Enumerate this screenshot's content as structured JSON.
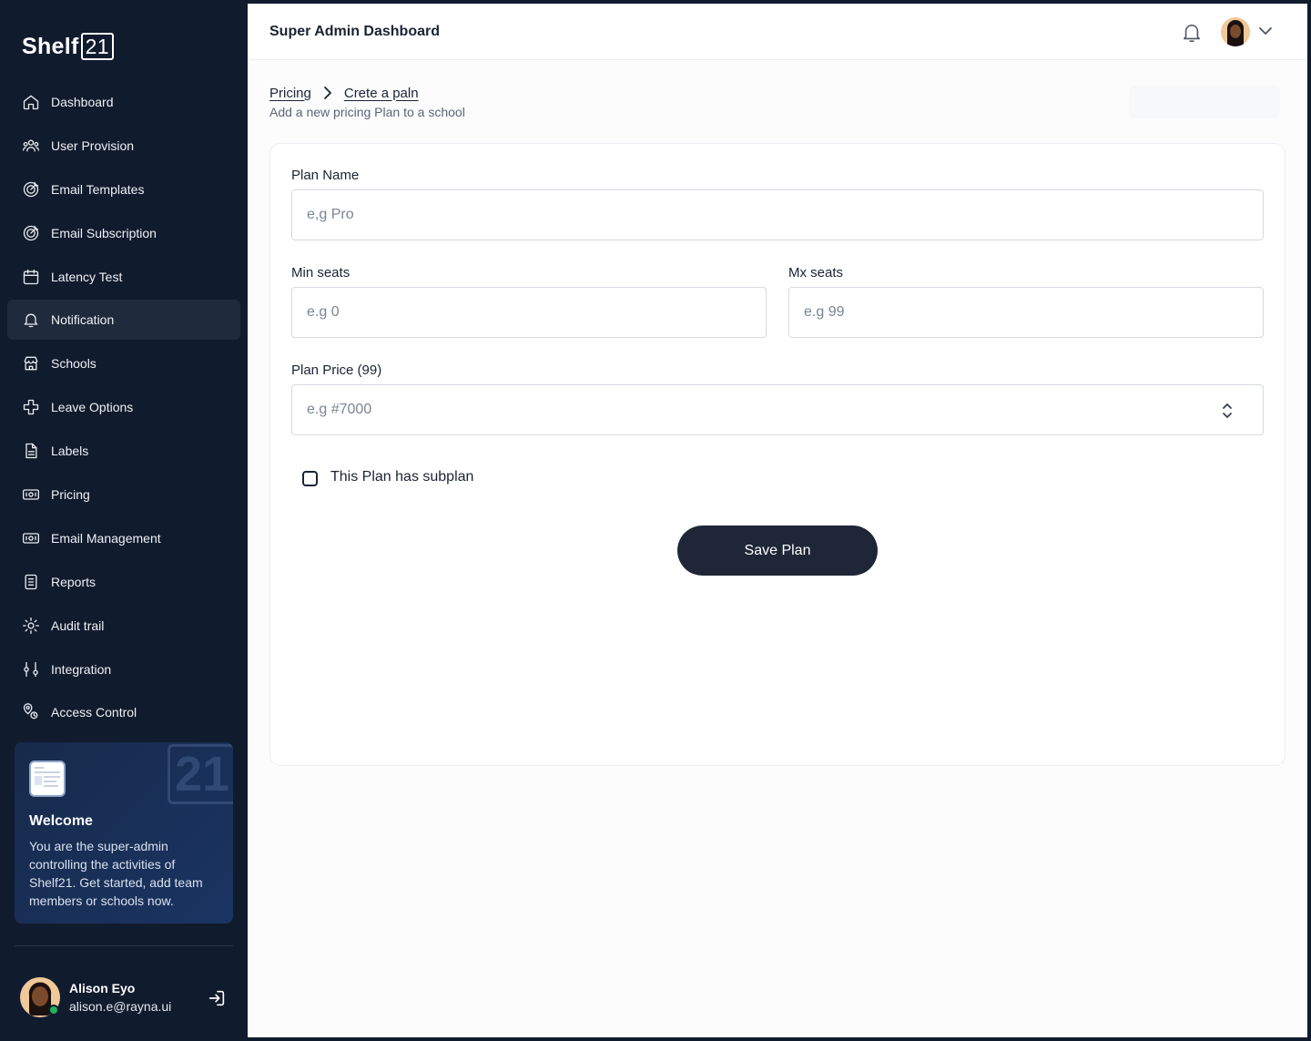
{
  "app": {
    "logo_text": "Shelf",
    "logo_box": "21"
  },
  "sidebar": {
    "items": [
      {
        "label": "Dashboard",
        "icon": "home-icon"
      },
      {
        "label": "User Provision",
        "icon": "users-icon"
      },
      {
        "label": "Email Templates",
        "icon": "target-icon"
      },
      {
        "label": "Email Subscription",
        "icon": "target-icon"
      },
      {
        "label": "Latency Test",
        "icon": "calendar-icon"
      },
      {
        "label": "Notification",
        "icon": "bell-icon",
        "active": true
      },
      {
        "label": "Schools",
        "icon": "store-icon"
      },
      {
        "label": "Leave Options",
        "icon": "plus-cross-icon"
      },
      {
        "label": "Labels",
        "icon": "document-icon"
      },
      {
        "label": "Pricing",
        "icon": "money-icon"
      },
      {
        "label": "Email Management",
        "icon": "money-icon"
      },
      {
        "label": "Reports",
        "icon": "report-icon"
      },
      {
        "label": "Audit trail",
        "icon": "settings-gear-icon"
      },
      {
        "label": "Integration",
        "icon": "sliders-icon"
      },
      {
        "label": "Access Control",
        "icon": "location-pins-icon"
      }
    ],
    "welcome": {
      "title": "Welcome",
      "body": "You are the super-admin controlling the activities of Shelf21. Get started, add team members or schools now.",
      "watermark": "21"
    },
    "user": {
      "name": "Alison Eyo",
      "email": "alison.e@rayna.ui"
    }
  },
  "header": {
    "title": "Super Admin Dashboard"
  },
  "breadcrumb": {
    "parent": "Pricing",
    "current": "Crete a paln"
  },
  "page": {
    "subtitle": "Add a new pricing Plan to a school"
  },
  "form": {
    "plan_name": {
      "label": "Plan Name",
      "placeholder": "e,g Pro",
      "value": ""
    },
    "min_seats": {
      "label": "Min seats",
      "placeholder": "e.g 0",
      "value": ""
    },
    "max_seats": {
      "label": "Mx seats",
      "placeholder": "e.g 99",
      "value": ""
    },
    "plan_price": {
      "label": "Plan Price (99)",
      "placeholder": "e.g #7000",
      "value": ""
    },
    "subplan_checkbox": {
      "label": "This Plan has subplan",
      "checked": false
    },
    "save_label": "Save Plan"
  },
  "colors": {
    "sidebar_bg": "#111b2e",
    "active_item_bg": "#1f2a3d",
    "primary_button": "#1e2638",
    "online_status": "#22b35a"
  }
}
